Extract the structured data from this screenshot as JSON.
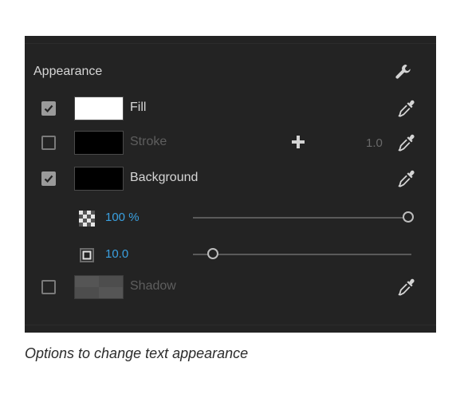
{
  "appearance": {
    "title": "Appearance",
    "fill": {
      "label": "Fill",
      "checked": true,
      "color": "#ffffff"
    },
    "stroke": {
      "label": "Stroke",
      "checked": false,
      "color": "#000000",
      "width": "1.0"
    },
    "background": {
      "label": "Background",
      "checked": true,
      "color": "#000000",
      "opacity": {
        "value": "100 %",
        "fraction": 1.0
      },
      "size": {
        "value": "10.0",
        "fraction": 0.09
      }
    },
    "shadow": {
      "label": "Shadow",
      "checked": false
    }
  },
  "caption": "Options to change text appearance",
  "icons": {
    "section_action": "wrench-icon",
    "picker": "eyedropper-icon",
    "add": "plus-icon",
    "opacity": "checkerboard-icon",
    "size": "square-outline-icon"
  },
  "colors": {
    "accent": "#3aa0e0",
    "panel": "#232323"
  }
}
